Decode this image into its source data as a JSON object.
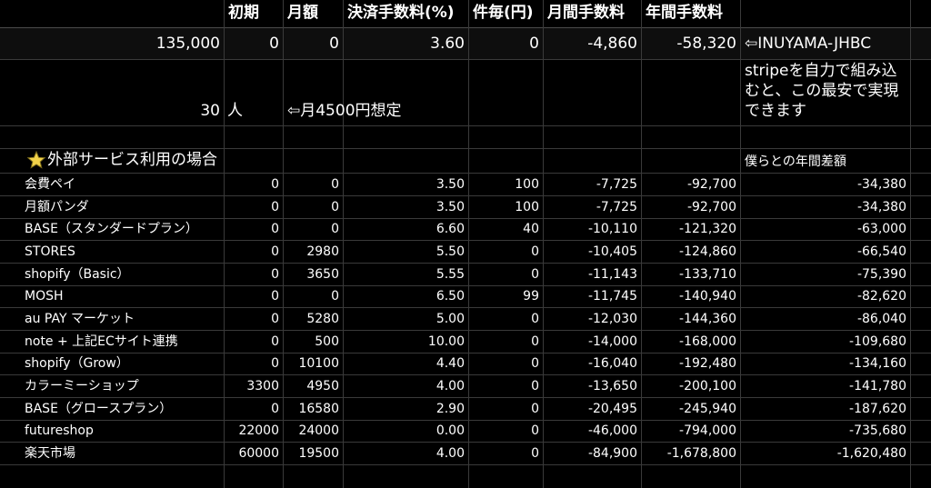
{
  "header": {
    "col_initial": "初期",
    "col_monthly": "月額",
    "col_fee_rate": "決済手数料(%)",
    "col_per_item": "件毎(円)",
    "col_monthly_fee": "月間手数料",
    "col_annual_fee": "年間手数料"
  },
  "own": {
    "initial": "135,000",
    "monthly": "0",
    "rate": "0",
    "fee_rate": "3.60",
    "per_item": "0",
    "monthly_fee": "-4,860",
    "annual_fee": "-58,320",
    "label": "⇦INUYAMA-JHBC"
  },
  "people": {
    "count": "30",
    "unit": "人",
    "assumption": "⇦月4500円想定",
    "stripe_note": "stripeを自力で組み込むと、この最安で実現できます"
  },
  "section": {
    "title": "外部サービス利用の場合",
    "diff_label": "僕らとの年間差額"
  },
  "rows": [
    {
      "name": "会費ペイ",
      "initial": "0",
      "monthly": "0",
      "rate": "3.50",
      "per": "100",
      "mfee": "-7,725",
      "afee": "-92,700",
      "diff": "-34,380"
    },
    {
      "name": "月額パンダ",
      "initial": "0",
      "monthly": "0",
      "rate": "3.50",
      "per": "100",
      "mfee": "-7,725",
      "afee": "-92,700",
      "diff": "-34,380"
    },
    {
      "name": "BASE（スタンダードプラン）",
      "initial": "0",
      "monthly": "0",
      "rate": "6.60",
      "per": "40",
      "mfee": "-10,110",
      "afee": "-121,320",
      "diff": "-63,000"
    },
    {
      "name": "STORES",
      "initial": "0",
      "monthly": "2980",
      "rate": "5.50",
      "per": "0",
      "mfee": "-10,405",
      "afee": "-124,860",
      "diff": "-66,540"
    },
    {
      "name": "shopify（Basic）",
      "initial": "0",
      "monthly": "3650",
      "rate": "5.55",
      "per": "0",
      "mfee": "-11,143",
      "afee": "-133,710",
      "diff": "-75,390"
    },
    {
      "name": "MOSH",
      "initial": "0",
      "monthly": "0",
      "rate": "6.50",
      "per": "99",
      "mfee": "-11,745",
      "afee": "-140,940",
      "diff": "-82,620"
    },
    {
      "name": "au PAY マーケット",
      "initial": "0",
      "monthly": "5280",
      "rate": "5.00",
      "per": "0",
      "mfee": "-12,030",
      "afee": "-144,360",
      "diff": "-86,040"
    },
    {
      "name": "note + 上記ECサイト連携",
      "initial": "0",
      "monthly": "500",
      "rate": "10.00",
      "per": "0",
      "mfee": "-14,000",
      "afee": "-168,000",
      "diff": "-109,680"
    },
    {
      "name": "shopify（Grow）",
      "initial": "0",
      "monthly": "10100",
      "rate": "4.40",
      "per": "0",
      "mfee": "-16,040",
      "afee": "-192,480",
      "diff": "-134,160"
    },
    {
      "name": "カラーミーショップ",
      "initial": "3300",
      "monthly": "4950",
      "rate": "4.00",
      "per": "0",
      "mfee": "-13,650",
      "afee": "-200,100",
      "diff": "-141,780"
    },
    {
      "name": "BASE（グロースプラン）",
      "initial": "0",
      "monthly": "16580",
      "rate": "2.90",
      "per": "0",
      "mfee": "-20,495",
      "afee": "-245,940",
      "diff": "-187,620"
    },
    {
      "name": "futureshop",
      "initial": "22000",
      "monthly": "24000",
      "rate": "0.00",
      "per": "0",
      "mfee": "-46,000",
      "afee": "-794,000",
      "diff": "-735,680"
    },
    {
      "name": "楽天市場",
      "initial": "60000",
      "monthly": "19500",
      "rate": "4.00",
      "per": "0",
      "mfee": "-84,900",
      "afee": "-1,678,800",
      "diff": "-1,620,480"
    }
  ],
  "icons": {
    "section_star": "star-icon"
  },
  "colors": {
    "background": "#000000",
    "grid": "#3a3a3a",
    "text": "#ffffff",
    "star": "#f2d24a"
  }
}
